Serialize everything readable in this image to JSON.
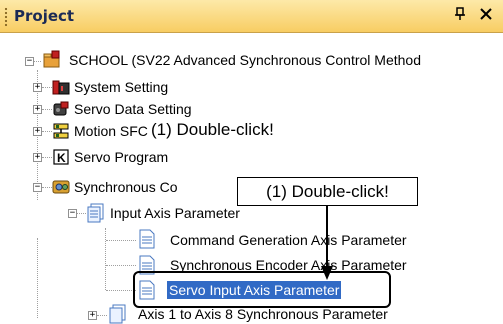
{
  "panel": {
    "title": "Project",
    "pin_glyph": "Ԃ",
    "close_glyph": "✕"
  },
  "tree": {
    "root": "SCHOOL (SV22 Advanced Synchronous Control Method",
    "items": [
      {
        "label": "System Setting",
        "icon": "system-setting-icon",
        "expander": "+"
      },
      {
        "label": "Servo Data Setting",
        "icon": "servo-data-icon",
        "expander": "+"
      },
      {
        "label": "Motion SFC",
        "icon": "motion-sfc-icon",
        "expander": "+"
      },
      {
        "label": "Servo Program",
        "icon": "servo-program-icon",
        "expander": "+"
      },
      {
        "label": "Synchronous Co",
        "icon": "synchronous-control-icon",
        "expander": "−"
      }
    ],
    "input_axis": {
      "label": "Input Axis Parameter",
      "expander": "−"
    },
    "children": [
      {
        "label": "Command Generation Axis Parameter"
      },
      {
        "label": "Synchronous Encoder Axis Parameter"
      },
      {
        "label": "Servo Input Axis Parameter",
        "selected": true
      }
    ],
    "axis_params": {
      "label": "Axis 1 to Axis 8   Synchronous Parameter",
      "expander": "+"
    }
  },
  "callouts": {
    "inline": "(1) Double-click!",
    "boxed": "(1) Double-click!"
  },
  "colors": {
    "title_bar_top": "#fde9a8",
    "title_bar_bottom": "#f8cd63",
    "selection": "#316ac5"
  }
}
